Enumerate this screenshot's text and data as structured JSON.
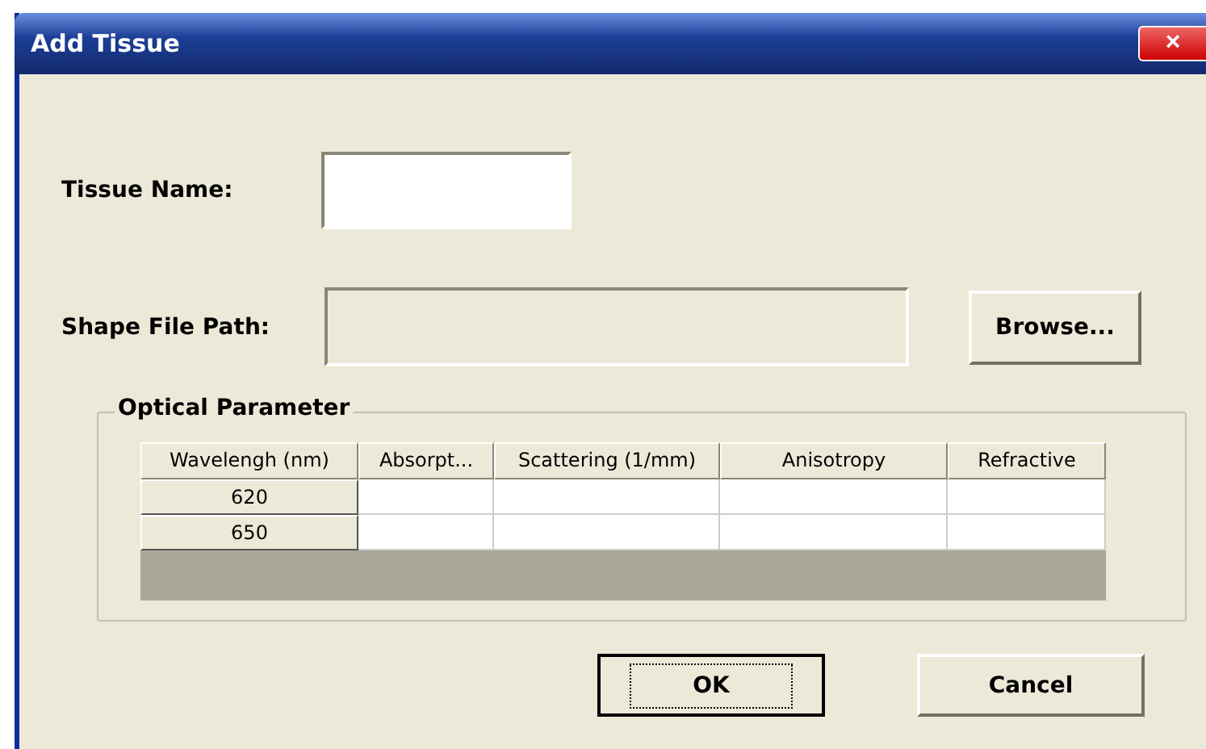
{
  "window": {
    "title": "Add Tissue",
    "close_label": "×"
  },
  "tissue_name": {
    "label": "Tissue Name:"
  },
  "shape_file_path": {
    "label": "Shape File Path:",
    "disabled": true
  },
  "browse_button": "Browse...",
  "optical_parameter": {
    "title": "Optical Parameter",
    "table": {
      "columns": [
        "Wavelengh (nm)",
        "Absorpt...",
        "Scattering (1/mm)",
        "Anisotropy",
        "Refractive"
      ],
      "rows": [
        {
          "wavelength": "620"
        },
        {
          "wavelength": "650"
        }
      ]
    }
  },
  "buttons": [
    {
      "label": "OK",
      "default": true
    },
    {
      "label": "Cancel",
      "default": false
    }
  ]
}
